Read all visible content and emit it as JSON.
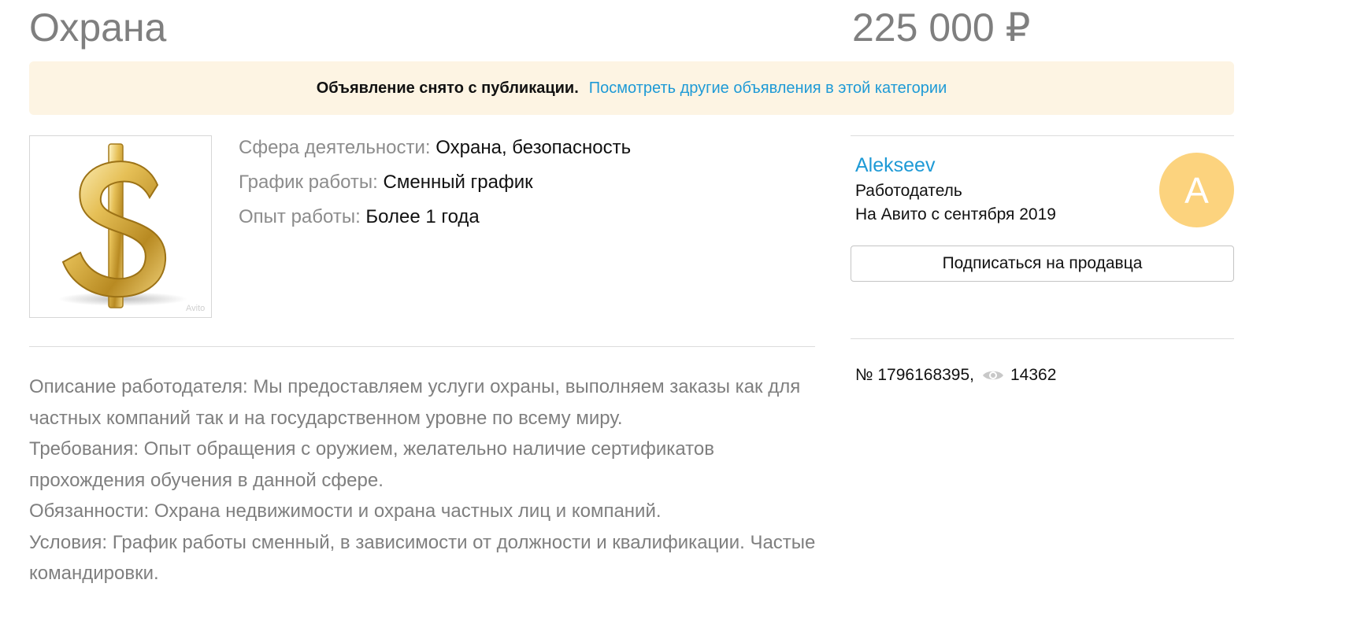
{
  "listing": {
    "title": "Охрана",
    "price": "225 000 ₽"
  },
  "notice": {
    "text": "Объявление снято с публикации.",
    "link": "Посмотреть другие объявления в этой категории"
  },
  "photo": {
    "icon": "dollar-sign-icon",
    "watermark": "Avito"
  },
  "params": [
    {
      "key": "Сфера деятельности:",
      "value": "Охрана, безопасность"
    },
    {
      "key": "График работы:",
      "value": "Сменный график"
    },
    {
      "key": "Опыт работы:",
      "value": "Более 1 года"
    }
  ],
  "description": [
    "Описание работодателя: Мы предоставляем услуги охраны, выполняем заказы как для частных компаний так и на государственном уровне по всему миру.",
    "Требования: Опыт обращения с оружием, желательно наличие сертификатов прохождения обучения в данной сфере.",
    "Обязанности: Охрана недвижимости и охрана частных лиц и компаний.",
    "Условия: График работы сменный, в зависимости от должности и квалификации. Частые командировки."
  ],
  "seller": {
    "name": "Alekseev",
    "role": "Работодатель",
    "since": "На Авито с сентября 2019",
    "avatar_letter": "A",
    "avatar_color": "#fcd37e",
    "subscribe_label": "Подписаться на продавца"
  },
  "meta": {
    "number": "№ 1796168395,",
    "views_icon": "eye-icon",
    "views": "14362"
  },
  "colors": {
    "link": "#1e9ad6",
    "notice_bg": "#fdf4e3",
    "muted_text": "#7f7f7f"
  }
}
